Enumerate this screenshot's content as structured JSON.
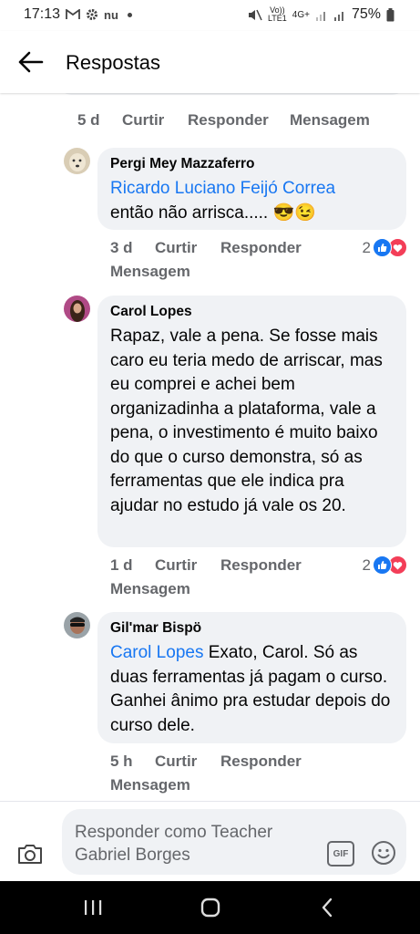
{
  "status_bar": {
    "time": "17:13",
    "carrier_badge": "nu",
    "volte": "Vo))",
    "lte": "LTE1",
    "network": "4G+",
    "battery": "75%"
  },
  "header": {
    "title": "Respostas"
  },
  "previous_comment": {
    "time": "5 d",
    "like_label": "Curtir",
    "reply_label": "Responder",
    "message_label": "Mensagem"
  },
  "comments": [
    {
      "author": "Pergi Mey Mazzaferro",
      "mention": "Ricardo Luciano Feijó Correa",
      "text": "então não arrisca..... 😎😉",
      "time": "3 d",
      "like_label": "Curtir",
      "reply_label": "Responder",
      "message_label": "Mensagem",
      "reactions_count": "2"
    },
    {
      "author": "Carol Lopes",
      "mention": "",
      "text": "Rapaz, vale a pena. Se fosse mais caro eu teria medo de arriscar, mas eu comprei e achei bem organizadinha a plataforma, vale a pena, o investimento é muito baixo do que o curso demonstra, só as ferramentas que ele indica pra ajudar no estudo já vale os 20.",
      "time": "1 d",
      "like_label": "Curtir",
      "reply_label": "Responder",
      "message_label": "Mensagem",
      "reactions_count": "2"
    },
    {
      "author": "Gil'mar Bispö",
      "mention": "Carol Lopes",
      "text": " Exato, Carol. Só as duas ferramentas já pagam o curso. Ganhei ânimo pra estudar depois do curso dele.",
      "time": "5 h",
      "like_label": "Curtir",
      "reply_label": "Responder",
      "message_label": "Mensagem"
    }
  ],
  "composer": {
    "placeholder": "Responder como Teacher Gabriel Borges",
    "gif_label": "GIF"
  },
  "colors": {
    "link": "#1877f2",
    "bubble": "#f0f2f5",
    "secondary_text": "#65676b",
    "like_blue": "#1877f2",
    "love_red": "#f33e58"
  }
}
